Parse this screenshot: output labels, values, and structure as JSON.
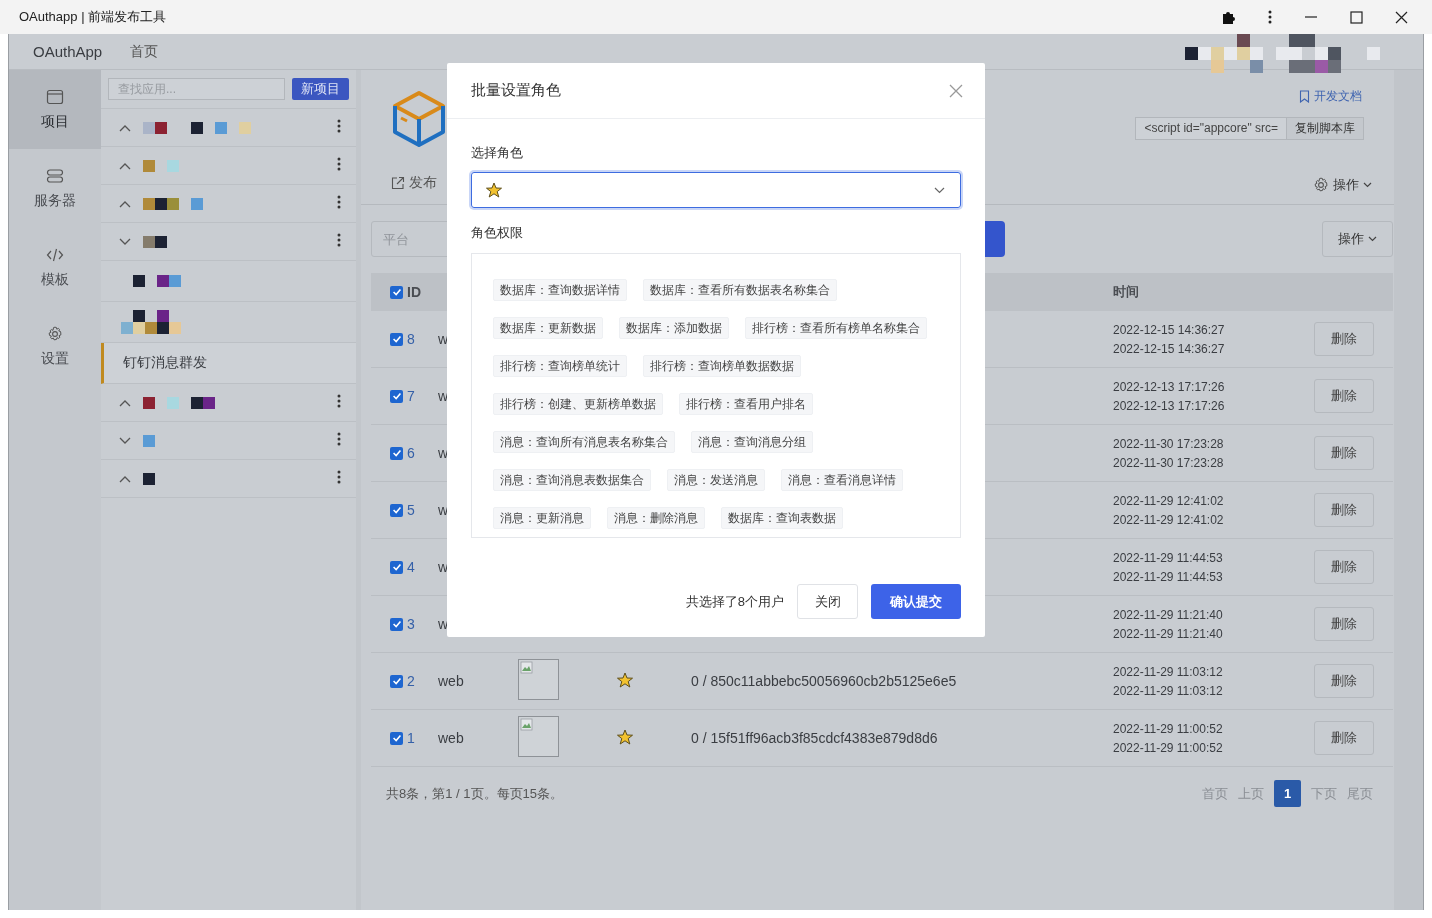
{
  "window": {
    "title": "OAuthapp | 前端发布工具"
  },
  "top_nav": {
    "brand": "OAuthApp",
    "items": [
      {
        "label": "首页"
      }
    ]
  },
  "side_nav": [
    {
      "label": "项目",
      "selected": true
    },
    {
      "label": "服务器",
      "selected": false
    },
    {
      "label": "模板",
      "selected": false
    },
    {
      "label": "设置",
      "selected": false
    }
  ],
  "project_list": {
    "search_placeholder": "查找应用...",
    "new_button": "新项目",
    "items": [
      {
        "kind": "redacted-group",
        "expanded": true,
        "selected": false
      },
      {
        "kind": "redacted-group",
        "expanded": true,
        "selected": false
      },
      {
        "kind": "redacted-group",
        "expanded": true,
        "selected": false
      },
      {
        "kind": "redacted-group",
        "expanded": false,
        "selected": false
      },
      {
        "kind": "redacted-app",
        "selected": false
      },
      {
        "kind": "redacted-app",
        "selected": false
      },
      {
        "kind": "app",
        "label": "钉钉消息群发",
        "selected": true
      },
      {
        "kind": "redacted-group",
        "expanded": true,
        "selected": false
      },
      {
        "kind": "redacted-group",
        "expanded": false,
        "selected": false
      },
      {
        "kind": "redacted-group",
        "expanded": true,
        "selected": false
      }
    ]
  },
  "app_header": {
    "publish_link": "发布",
    "docs_link": "开发文档",
    "script_snippet": "<script id=\"appcore\" src=",
    "copy_button": "复制脚本库",
    "actions_menu": "操作"
  },
  "filter": {
    "platform_placeholder": "平台",
    "actions_button": "操作"
  },
  "table": {
    "all_checked": true,
    "columns": [
      {
        "label": "ID"
      },
      {
        "label": "时间"
      }
    ],
    "rows": [
      {
        "checked": true,
        "id": "8",
        "platform": "w",
        "times": [
          "2022-12-15 14:36:27",
          "2022-12-15 14:36:27"
        ],
        "delete": "删除"
      },
      {
        "checked": true,
        "id": "7",
        "platform": "w",
        "times": [
          "2022-12-13 17:17:26",
          "2022-12-13 17:17:26"
        ],
        "delete": "删除"
      },
      {
        "checked": true,
        "id": "6",
        "platform": "w",
        "times": [
          "2022-11-30 17:23:28",
          "2022-11-30 17:23:28"
        ],
        "delete": "删除"
      },
      {
        "checked": true,
        "id": "5",
        "platform": "w",
        "times": [
          "2022-11-29 12:41:02",
          "2022-11-29 12:41:02"
        ],
        "delete": "删除"
      },
      {
        "checked": true,
        "id": "4",
        "platform": "w",
        "times": [
          "2022-11-29 11:44:53",
          "2022-11-29 11:44:53"
        ],
        "delete": "删除"
      },
      {
        "checked": true,
        "id": "3",
        "platform": "w",
        "times": [
          "2022-11-29 11:21:40",
          "2022-11-29 11:21:40"
        ],
        "delete": "删除"
      },
      {
        "checked": true,
        "id": "2",
        "platform": "web",
        "key": "0 / 850c11abbebc50056960cb2b5125e6e5",
        "times": [
          "2022-11-29 11:03:12",
          "2022-11-29 11:03:12"
        ],
        "delete": "删除"
      },
      {
        "checked": true,
        "id": "1",
        "platform": "web",
        "key": "0 / 15f51ff96acb3f85cdcf4383e879d8d6",
        "times": [
          "2022-11-29 11:00:52",
          "2022-11-29 11:00:52"
        ],
        "delete": "删除"
      }
    ]
  },
  "pagination": {
    "summary": "共8条，第1 / 1页。每页15条。",
    "pages": [
      {
        "label": "首页",
        "kind": "nav",
        "selected": false
      },
      {
        "label": "上页",
        "kind": "nav",
        "selected": false
      },
      {
        "label": "1",
        "kind": "page",
        "selected": true
      },
      {
        "label": "下页",
        "kind": "nav",
        "selected": false
      },
      {
        "label": "尾页",
        "kind": "nav",
        "selected": false
      }
    ]
  },
  "modal": {
    "title": "批量设置角色",
    "role_label": "选择角色",
    "permissions_label": "角色权限",
    "permissions": [
      "数据库：查询数据详情",
      "数据库：查看所有数据表名称集合",
      "数据库：更新数据",
      "数据库：添加数据",
      "排行榜：查看所有榜单名称集合",
      "排行榜：查询榜单统计",
      "排行榜：查询榜单数据数据",
      "排行榜：创建、更新榜单数据",
      "排行榜：查看用户排名",
      "消息：查询所有消息表名称集合",
      "消息：查询消息分组",
      "消息：查询消息表数据集合",
      "消息：发送消息",
      "消息：查看消息详情",
      "消息：更新消息",
      "消息：删除消息",
      "数据库：查询表数据"
    ],
    "selection_summary": "共选择了8个用户",
    "close_button": "关闭",
    "submit_button": "确认提交"
  }
}
